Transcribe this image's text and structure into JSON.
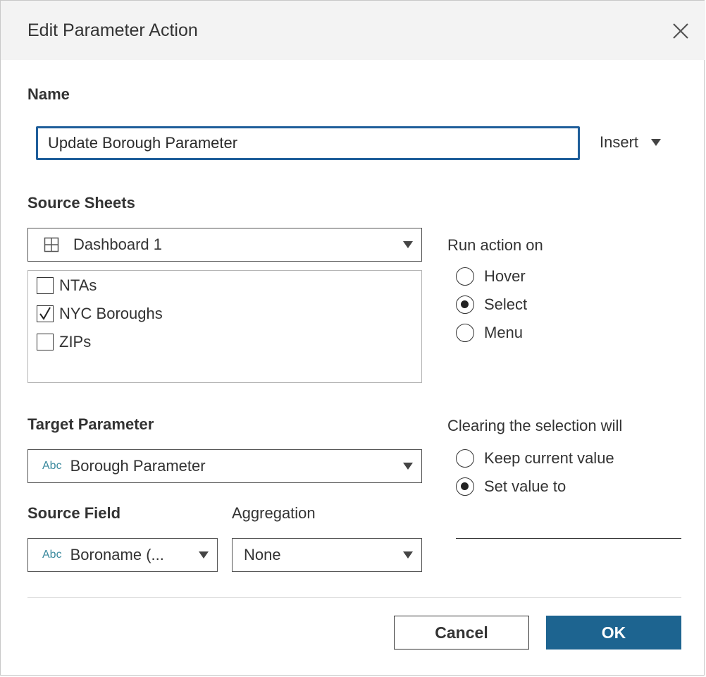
{
  "dialog": {
    "title": "Edit Parameter Action"
  },
  "name_section": {
    "label": "Name",
    "value": "Update Borough Parameter",
    "insert_label": "Insert"
  },
  "source_sheets": {
    "label": "Source Sheets",
    "selected": "Dashboard 1",
    "items": [
      {
        "label": "NTAs",
        "checked": false
      },
      {
        "label": "NYC Boroughs",
        "checked": true
      },
      {
        "label": "ZIPs",
        "checked": false
      }
    ]
  },
  "run_action_on": {
    "label": "Run action on",
    "options": [
      {
        "label": "Hover",
        "selected": false
      },
      {
        "label": "Select",
        "selected": true
      },
      {
        "label": "Menu",
        "selected": false
      }
    ]
  },
  "target_parameter": {
    "label": "Target Parameter",
    "type_badge": "Abc",
    "value": "Borough Parameter"
  },
  "source_field": {
    "label": "Source Field",
    "type_badge": "Abc",
    "value": "Boroname (..."
  },
  "aggregation": {
    "label": "Aggregation",
    "value": "None"
  },
  "clearing": {
    "label": "Clearing the selection will",
    "options": [
      {
        "label": "Keep current value",
        "selected": false
      },
      {
        "label": "Set value to",
        "selected": true
      }
    ],
    "set_value": ""
  },
  "buttons": {
    "cancel": "Cancel",
    "ok": "OK"
  },
  "colors": {
    "focus_border": "#1f5e9a",
    "ok_button": "#1d6490",
    "type_badge": "#3b8a9e"
  }
}
